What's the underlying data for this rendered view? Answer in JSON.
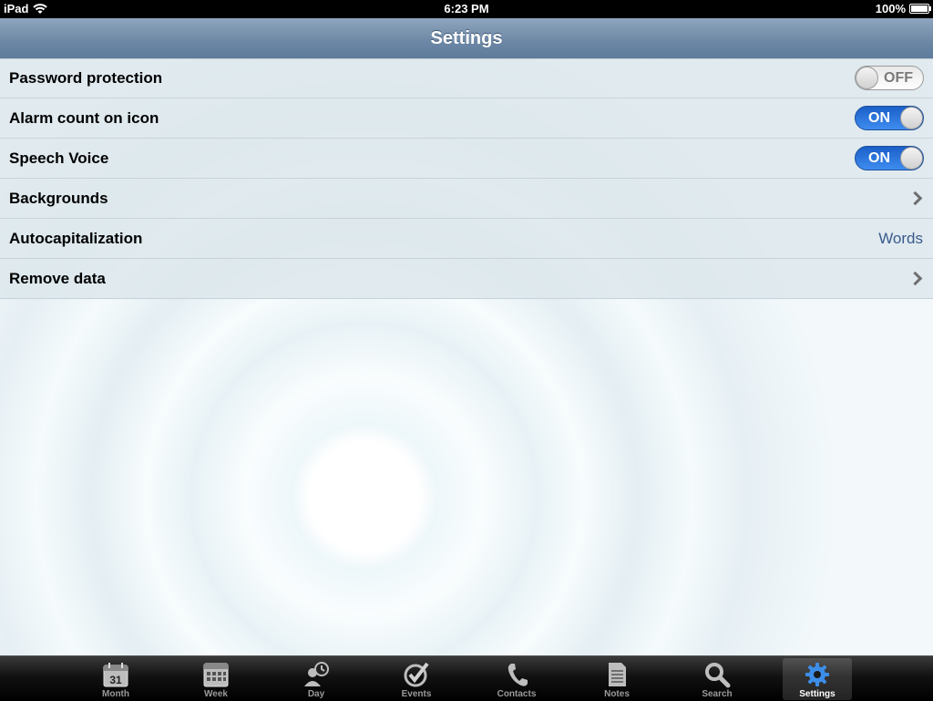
{
  "status_bar": {
    "device": "iPad",
    "time": "6:23 PM",
    "battery": "100%"
  },
  "nav": {
    "title": "Settings"
  },
  "settings": [
    {
      "label": "Password protection",
      "control": "toggle",
      "state": "OFF"
    },
    {
      "label": "Alarm count on icon",
      "control": "toggle",
      "state": "ON"
    },
    {
      "label": "Speech Voice",
      "control": "toggle",
      "state": "ON"
    },
    {
      "label": "Backgrounds",
      "control": "chevron"
    },
    {
      "label": "Autocapitalization",
      "control": "value",
      "value": "Words"
    },
    {
      "label": "Remove data",
      "control": "chevron"
    }
  ],
  "tabbar": {
    "active": "Settings",
    "tabs": [
      {
        "label": "Month",
        "icon": "calendar-month-icon",
        "day": "31"
      },
      {
        "label": "Week",
        "icon": "calendar-week-icon"
      },
      {
        "label": "Day",
        "icon": "person-clock-icon"
      },
      {
        "label": "Events",
        "icon": "checkmark-circle-icon"
      },
      {
        "label": "Contacts",
        "icon": "phone-icon"
      },
      {
        "label": "Notes",
        "icon": "note-icon"
      },
      {
        "label": "Search",
        "icon": "magnifier-icon"
      },
      {
        "label": "Settings",
        "icon": "gear-icon"
      }
    ]
  },
  "colors": {
    "nav_bar": "#6c87a5",
    "toggle_on": "#2f7ae5",
    "value_text": "#3a5a8c"
  }
}
